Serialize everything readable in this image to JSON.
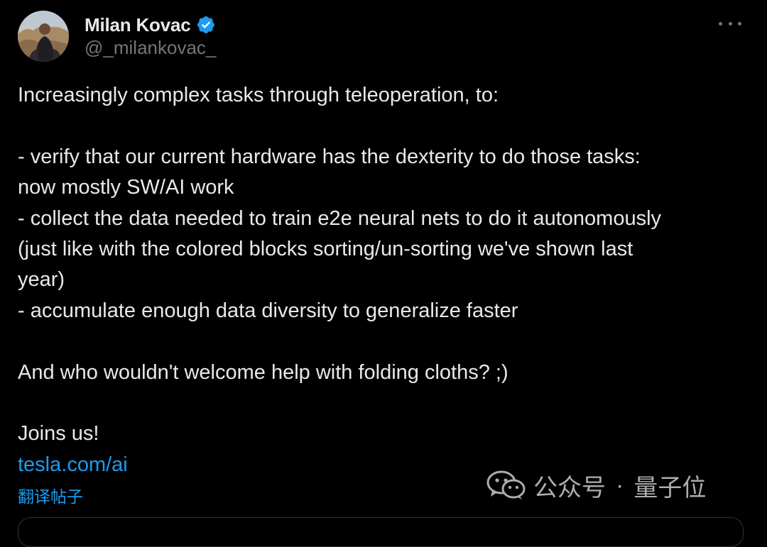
{
  "author": {
    "display_name": "Milan Kovac",
    "handle": "@_milankovac_",
    "verified": true
  },
  "tweet": {
    "lines": [
      "Increasingly complex tasks through teleoperation, to:",
      "",
      "- verify that our current hardware has the dexterity to do those tasks:",
      "now mostly SW/AI work",
      "- collect the data needed to train e2e neural nets to do it autonomously",
      "(just like with the colored blocks sorting/un-sorting we've shown last",
      "year)",
      "- accumulate enough data diversity to generalize faster",
      "",
      "And who wouldn't welcome help with folding cloths? ;)",
      "",
      "Joins us!"
    ],
    "link": "tesla.com/ai",
    "translate_label": "翻译帖子"
  },
  "watermark": {
    "text1": "公众号",
    "separator": "·",
    "text2": "量子位"
  },
  "icons": {
    "verified": "verified-badge-icon",
    "more": "more-options-icon",
    "watermark_logo": "wechat-icon"
  },
  "colors": {
    "background": "#000000",
    "text": "#e7e9ea",
    "secondary": "#71767b",
    "link": "#1d9bf0",
    "verified": "#1d9bf0"
  }
}
